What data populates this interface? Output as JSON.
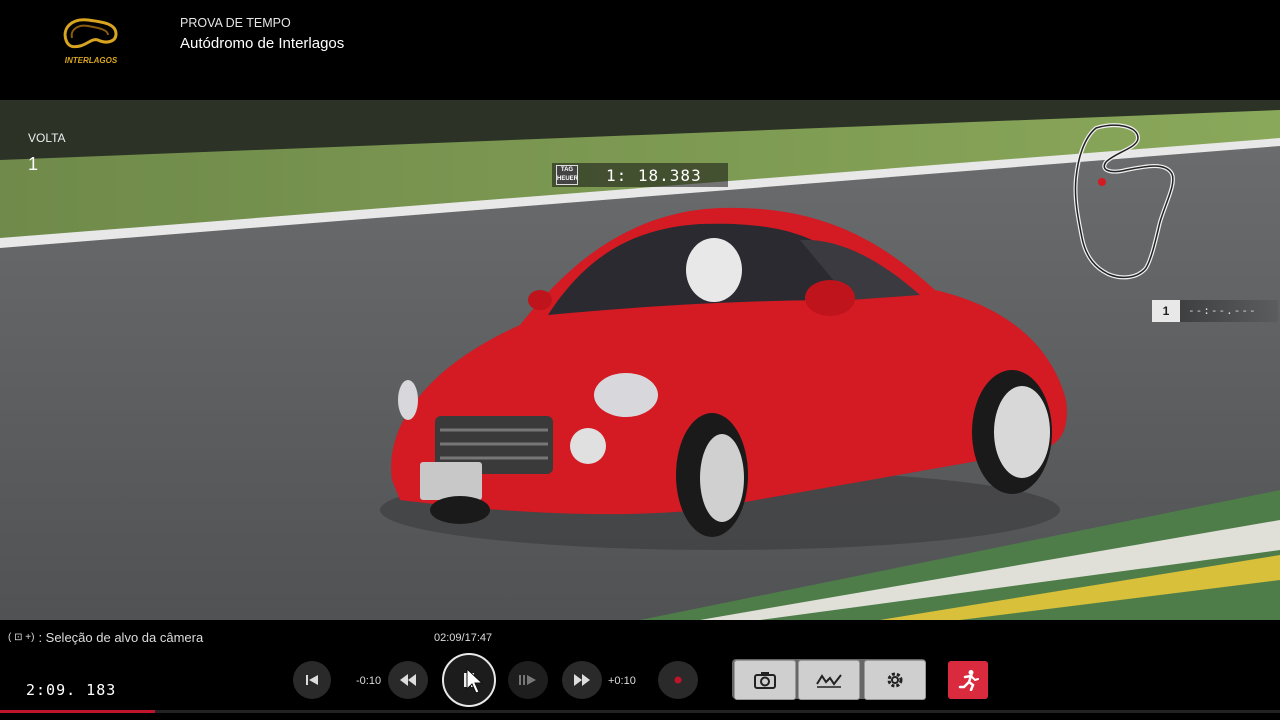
{
  "header": {
    "logo_text": "INTERLAGOS",
    "event_type": "PROVA DE TEMPO",
    "track_name": "Autódromo de Interlagos"
  },
  "hud": {
    "lap_label": "VOLTA",
    "lap_value": "1",
    "lap_timer": "1: 18.383",
    "timer_badge": "TAG HEUER",
    "position": "1",
    "position_time": "--:--.---"
  },
  "replay": {
    "camera_hint_buttons": "( ⊡ +)",
    "camera_hint_text": ": Seleção de alvo da câmera",
    "playback_time": "02:09/17:47",
    "total_time": "2:09. 183",
    "progress_fraction": 0.121,
    "rewind_label": "-0:10",
    "forward_label": "+0:10",
    "icons": {
      "skip_start": "skip-to-start-icon",
      "rewind": "rewind-icon",
      "pause": "pause-icon",
      "slow_motion": "slow-motion-icon",
      "fast_forward": "fast-forward-icon",
      "record": "record-icon",
      "camera": "camera-icon",
      "graph": "graph-icon",
      "settings": "gear-icon",
      "exit": "exit-running-icon"
    }
  },
  "colors": {
    "record_red": "#c0142a",
    "exit_red": "#d92a3e",
    "car_red": "#d41a22"
  }
}
